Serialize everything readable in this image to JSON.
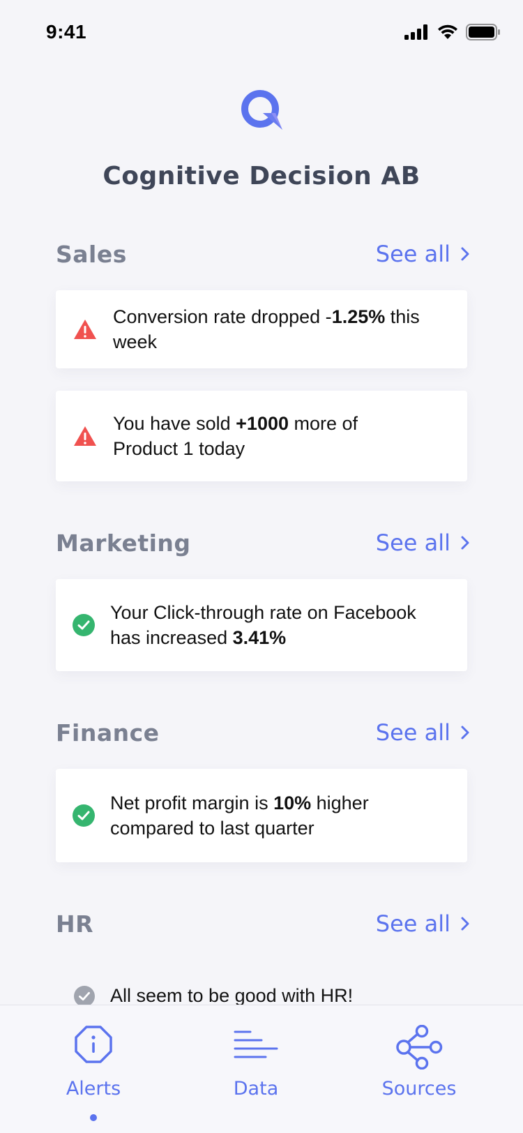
{
  "status_bar": {
    "time": "9:41"
  },
  "header": {
    "company": "Cognitive Decision AB"
  },
  "colors": {
    "accent": "#5b73ee",
    "warning": "#f0514f",
    "success": "#35b56f",
    "neutral": "#a0a4ae"
  },
  "sections": [
    {
      "title": "Sales",
      "see_all": "See all",
      "alerts": [
        {
          "icon": "warning-icon",
          "parts": [
            "Conversion rate dropped -",
            "1.25%",
            " this week"
          ]
        },
        {
          "icon": "warning-icon",
          "parts": [
            "You have sold ",
            "+1000",
            " more of Product 1 today"
          ]
        }
      ]
    },
    {
      "title": "Marketing",
      "see_all": "See all",
      "alerts": [
        {
          "icon": "check-circle-icon",
          "parts": [
            "Your Click-through rate on Facebook has increased ",
            "3.41%",
            ""
          ]
        }
      ]
    },
    {
      "title": "Finance",
      "see_all": "See all",
      "alerts": [
        {
          "icon": "check-circle-icon",
          "parts": [
            "Net profit margin is ",
            "10%",
            " higher compared to last quarter"
          ]
        }
      ]
    },
    {
      "title": "HR",
      "see_all": "See all",
      "alerts": [
        {
          "icon": "check-circle-icon",
          "parts": [
            "All seem to be good with HR!"
          ]
        }
      ]
    }
  ],
  "tabbar": {
    "tabs": [
      {
        "label": "Alerts",
        "icon": "alert-octagon-icon",
        "active": true
      },
      {
        "label": "Data",
        "icon": "data-lines-icon",
        "active": false
      },
      {
        "label": "Sources",
        "icon": "sources-network-icon",
        "active": false
      }
    ]
  }
}
